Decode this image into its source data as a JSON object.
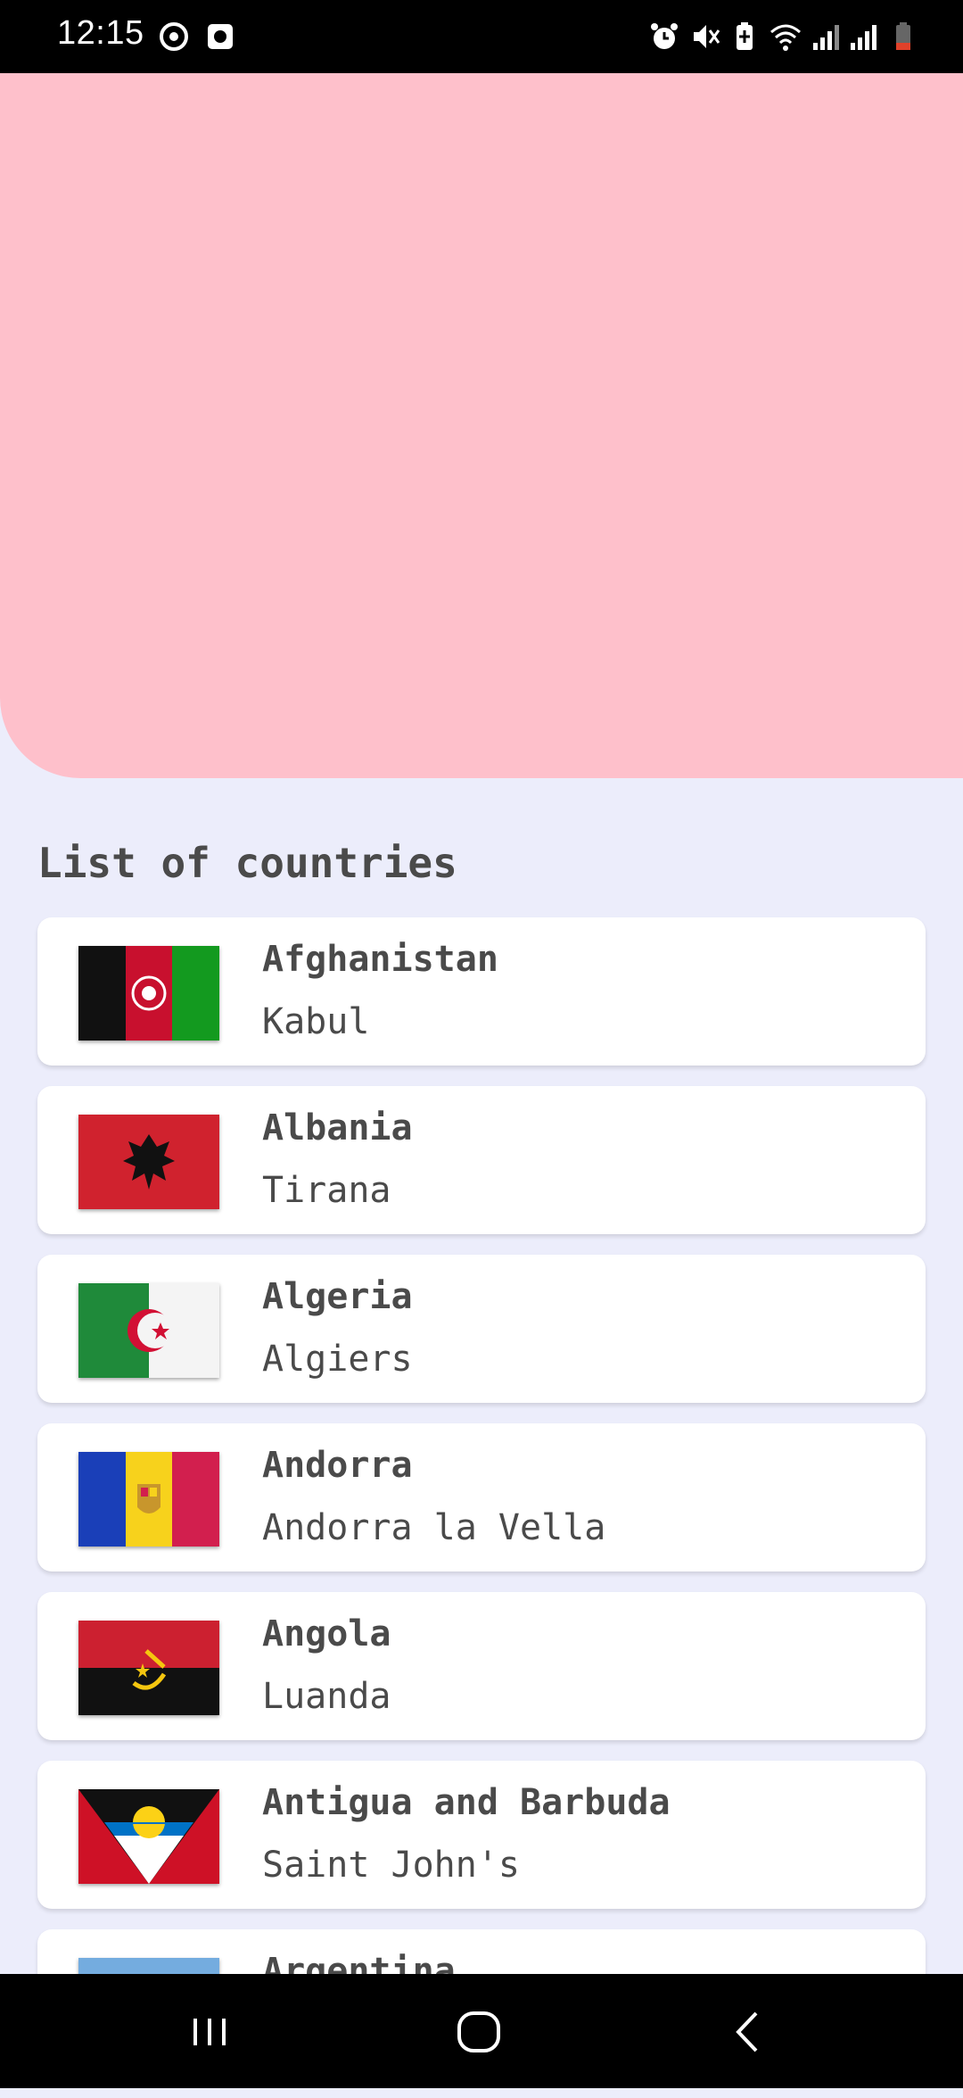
{
  "status_bar": {
    "time": "12:15",
    "icons": [
      "sync-icon",
      "screen-record-icon",
      "alarm-icon",
      "mute-icon",
      "battery-saver-icon",
      "wifi-icon",
      "signal-icon",
      "signal-icon",
      "battery-icon"
    ]
  },
  "header": {
    "color": "#fec0cb"
  },
  "list": {
    "title": "List of countries",
    "items": [
      {
        "name": "Afghanistan",
        "capital": "Kabul",
        "flag": "afghanistan-flag"
      },
      {
        "name": "Albania",
        "capital": "Tirana",
        "flag": "albania-flag"
      },
      {
        "name": "Algeria",
        "capital": "Algiers",
        "flag": "algeria-flag"
      },
      {
        "name": "Andorra",
        "capital": "Andorra la Vella",
        "flag": "andorra-flag"
      },
      {
        "name": "Angola",
        "capital": "Luanda",
        "flag": "angola-flag"
      },
      {
        "name": "Antigua and Barbuda",
        "capital": "Saint John's",
        "flag": "antigua-and-barbuda-flag"
      },
      {
        "name": "Argentina",
        "capital": "",
        "flag": "argentina-flag"
      }
    ]
  },
  "nav_bar": {
    "buttons": [
      "recent-apps-icon",
      "home-icon",
      "back-icon"
    ]
  },
  "colors": {
    "background": "#ecedfb",
    "text": "#4a4a4a"
  }
}
